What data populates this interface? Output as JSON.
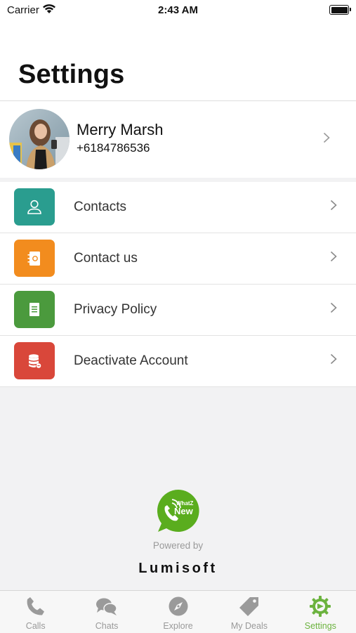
{
  "status_bar": {
    "carrier": "Carrier",
    "time": "2:43 AM"
  },
  "header": {
    "title": "Settings"
  },
  "profile": {
    "name": "Merry Marsh",
    "phone": "+6184786536"
  },
  "menu": {
    "items": [
      {
        "label": "Contacts",
        "icon": "person-icon",
        "color": "#2a9d8f"
      },
      {
        "label": "Contact us",
        "icon": "address-book-icon",
        "color": "#f28c1e"
      },
      {
        "label": "Privacy Policy",
        "icon": "document-icon",
        "color": "#4b9a3d"
      },
      {
        "label": "Deactivate Account",
        "icon": "database-remove-icon",
        "color": "#d9473a"
      }
    ]
  },
  "brand": {
    "logo_line1": "WhatZ",
    "logo_line2": "New",
    "powered_by": "Powered by",
    "company": "Lumisoft",
    "logo_color": "#5aad1e"
  },
  "tabbar": {
    "tabs": [
      {
        "label": "Calls",
        "icon": "phone-icon"
      },
      {
        "label": "Chats",
        "icon": "chat-bubbles-icon"
      },
      {
        "label": "Explore",
        "icon": "compass-icon"
      },
      {
        "label": "My Deals",
        "icon": "tag-icon"
      },
      {
        "label": "Settings",
        "icon": "gear-icon",
        "active": true
      }
    ],
    "active_color": "#6cb33f",
    "inactive_color": "#999999"
  }
}
